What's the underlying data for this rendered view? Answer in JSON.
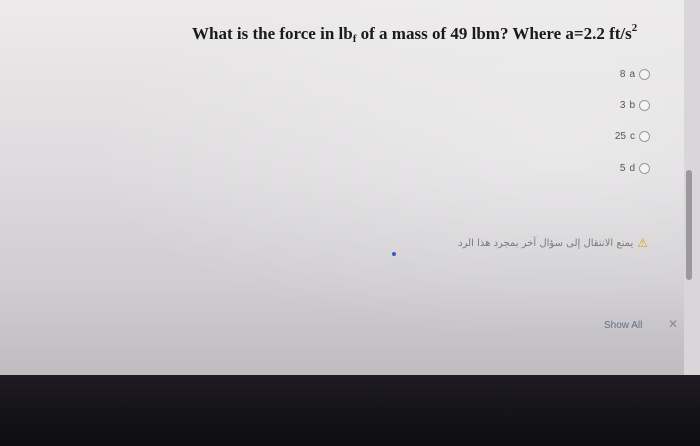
{
  "question": {
    "prefix": "What is the force in lb",
    "sub": "f",
    "middle": " of a mass of 49 lbm? Where a=2.2 ft/s",
    "sup": "2"
  },
  "options": [
    {
      "value": "8",
      "letter": "a"
    },
    {
      "value": "3",
      "letter": "b"
    },
    {
      "value": "25",
      "letter": "c"
    },
    {
      "value": "5",
      "letter": "d"
    }
  ],
  "warning": {
    "text": "يمنع الانتقال إلى سؤال آخر بمجرد هذا الرد",
    "icon": "warning-icon"
  },
  "notification": {
    "show_all_label": "Show All",
    "close_label": "✕"
  }
}
